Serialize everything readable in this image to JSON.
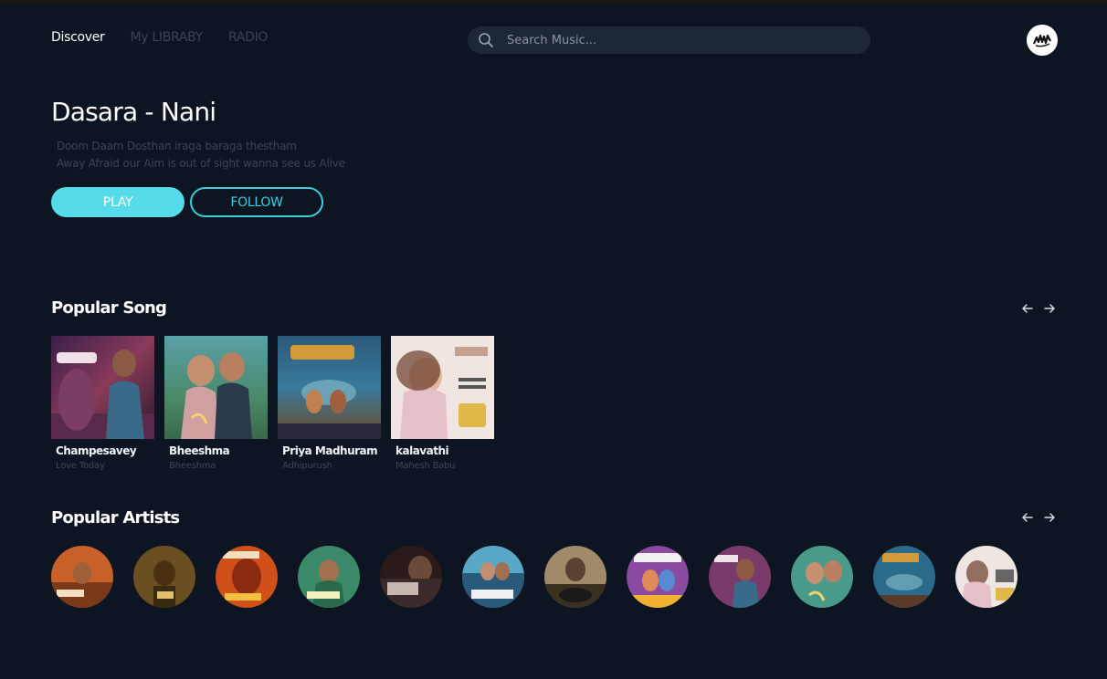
{
  "nav": {
    "discover": "Discover",
    "library": "My LIBRABY",
    "radio": "RADIO"
  },
  "search": {
    "placeholder": "Search Music..."
  },
  "hero": {
    "title": "Dasara - Nani",
    "lyric_line_1": "Doom Daam Dosthan iraga baraga thestham",
    "lyric_line_2": "Away Afraid our Aim is out of sight wanna see us Alive",
    "play_label": "PLAY",
    "follow_label": "FOLLOW"
  },
  "popular_songs": {
    "title": "Popular Song",
    "items": [
      {
        "title": "Champesavey",
        "subtitle": "Love Today"
      },
      {
        "title": "Bheeshma",
        "subtitle": "Bheeshma"
      },
      {
        "title": "Priya Madhuram",
        "subtitle": "Adhipurush"
      },
      {
        "title": "kalavathi",
        "subtitle": "Mahesh Babu"
      }
    ]
  },
  "popular_artists": {
    "title": "Popular Artists",
    "count": 12
  },
  "colors": {
    "background": "#0d1422",
    "accent": "#56dce8",
    "accent_border": "#39d0de",
    "search_bg": "#1e2736",
    "dim_text": "#3b4556"
  },
  "icons": {
    "search": "search-icon",
    "arrow_left": "arrow-left-icon",
    "arrow_right": "arrow-right-icon"
  }
}
